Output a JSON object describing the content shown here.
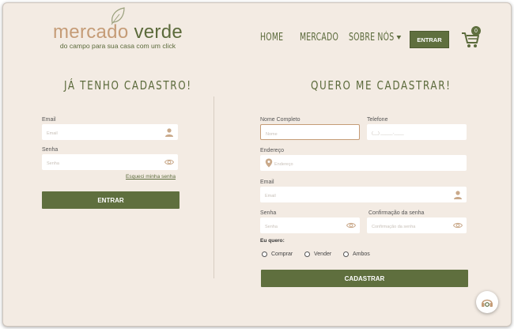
{
  "logo": {
    "title_part1": "mercado",
    "title_part2": "verde",
    "tagline": "do campo para sua casa com um click"
  },
  "nav": {
    "home": "HOME",
    "mercado": "MERCADO",
    "sobre": "SOBRE NÓS",
    "entrar": "ENTRAR",
    "cart_count": "0"
  },
  "login": {
    "heading": "JÁ TENHO CADASTRO!",
    "email_label": "Email",
    "email_placeholder": "Email",
    "senha_label": "Senha",
    "senha_placeholder": "Senha",
    "forgot": "Esqueci minha senha",
    "submit": "ENTRAR"
  },
  "register": {
    "heading": "QUERO ME CADASTRAR!",
    "nome_label": "Nome Completo",
    "nome_placeholder": "Nome",
    "telefone_label": "Telefone",
    "telefone_placeholder": "(__) _____-____",
    "endereco_label": "Endereço",
    "endereco_placeholder": "Endereço",
    "email_label": "Email",
    "email_placeholder": "Email",
    "senha_label": "Senha",
    "senha_placeholder": "Senha",
    "confirm_label": "Confirmação da senha",
    "confirm_placeholder": "Confirmação da senha",
    "eu_quero": "Eu quero:",
    "options": [
      "Comprar",
      "Vender",
      "Ambos"
    ],
    "submit": "CADASTRAR"
  },
  "colors": {
    "accent_green": "#5f6f3e",
    "accent_tan": "#c59c77",
    "background": "#f3ebe3"
  }
}
